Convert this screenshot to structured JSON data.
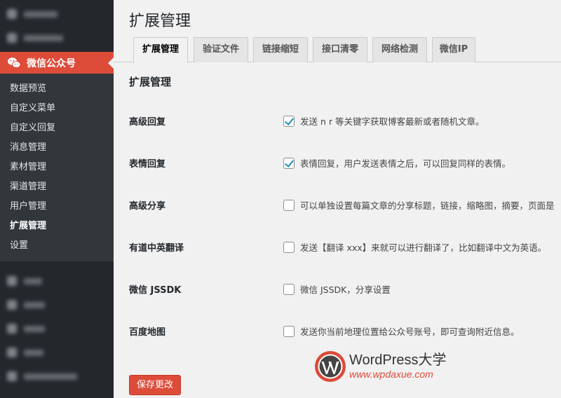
{
  "sidebar": {
    "active_menu": {
      "label": "微信公众号",
      "icon": "wechat-icon",
      "color": "#dd4b39"
    },
    "submenu": [
      {
        "label": "数据预览"
      },
      {
        "label": "自定义菜单"
      },
      {
        "label": "自定义回复"
      },
      {
        "label": "消息管理"
      },
      {
        "label": "素材管理"
      },
      {
        "label": "渠道管理"
      },
      {
        "label": "用户管理"
      },
      {
        "label": "扩展管理",
        "current": true
      },
      {
        "label": "设置"
      }
    ]
  },
  "main": {
    "page_title": "扩展管理",
    "tabs": [
      {
        "label": "扩展管理",
        "active": true
      },
      {
        "label": "验证文件"
      },
      {
        "label": "链接缩短"
      },
      {
        "label": "接口清零"
      },
      {
        "label": "网络检测"
      },
      {
        "label": "微信IP"
      }
    ],
    "section_title": "扩展管理",
    "rows": [
      {
        "label": "高级回复",
        "checked": true,
        "desc": "发送 n r 等关键字获取博客最新或者随机文章。"
      },
      {
        "label": "表情回复",
        "checked": true,
        "desc": "表情回复，用户发送表情之后，可以回复同样的表情。"
      },
      {
        "label": "高级分享",
        "checked": false,
        "desc": "可以单独设置每篇文章的分享标题，链接，缩略图，摘要，页面是"
      },
      {
        "label": "有道中英翻译",
        "checked": false,
        "desc": "发送【翻译 xxx】来就可以进行翻译了，比如翻译中文为英语。"
      },
      {
        "label": "微信 JSSDK",
        "checked": false,
        "desc": "微信 JSSDK，分享设置"
      },
      {
        "label": "百度地图",
        "checked": false,
        "desc": "发送你当前地理位置给公众号账号，即可查询附近信息。"
      }
    ],
    "save_label": "保存更改"
  },
  "watermark": {
    "title": "WordPress大学",
    "url": "www.wpdaxue.com"
  }
}
